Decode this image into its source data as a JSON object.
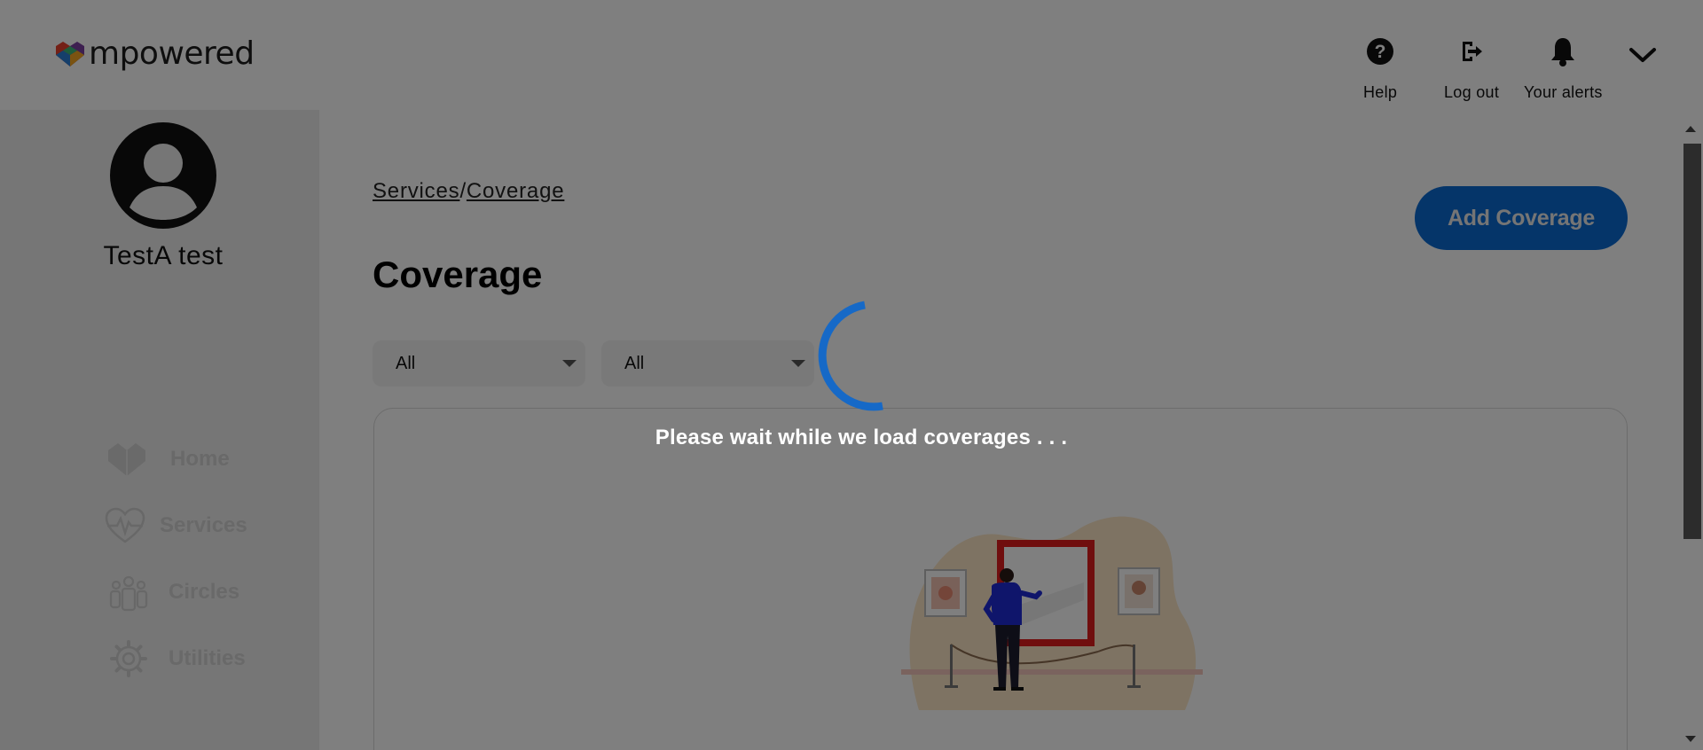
{
  "app": {
    "logo_text": "mpowered"
  },
  "header": {
    "help_label": "Help",
    "logout_label": "Log out",
    "alerts_label": "Your alerts",
    "icons": {
      "help": "help-circle-icon",
      "logout": "logout-icon",
      "alerts": "bell-icon",
      "menu": "chevron-down-icon"
    }
  },
  "sidebar": {
    "user_name": "TestA test",
    "items": [
      {
        "label": "Home",
        "icon": "heart-home-icon"
      },
      {
        "label": "Services",
        "icon": "heart-pulse-icon"
      },
      {
        "label": "Circles",
        "icon": "people-icon"
      },
      {
        "label": "Utilities",
        "icon": "gear-icon"
      }
    ]
  },
  "main": {
    "breadcrumb": {
      "parent": "Services",
      "separator": "/",
      "current": "Coverage"
    },
    "title": "Coverage",
    "add_button_label": "Add Coverage",
    "filters": [
      {
        "selected": "All"
      },
      {
        "selected": "All"
      }
    ]
  },
  "overlay": {
    "loading_text": "Please wait while we load coverages . . ."
  },
  "colors": {
    "accent": "#0b6ad3",
    "overlay": "#808080",
    "sidebar_bg": "#ececec"
  }
}
